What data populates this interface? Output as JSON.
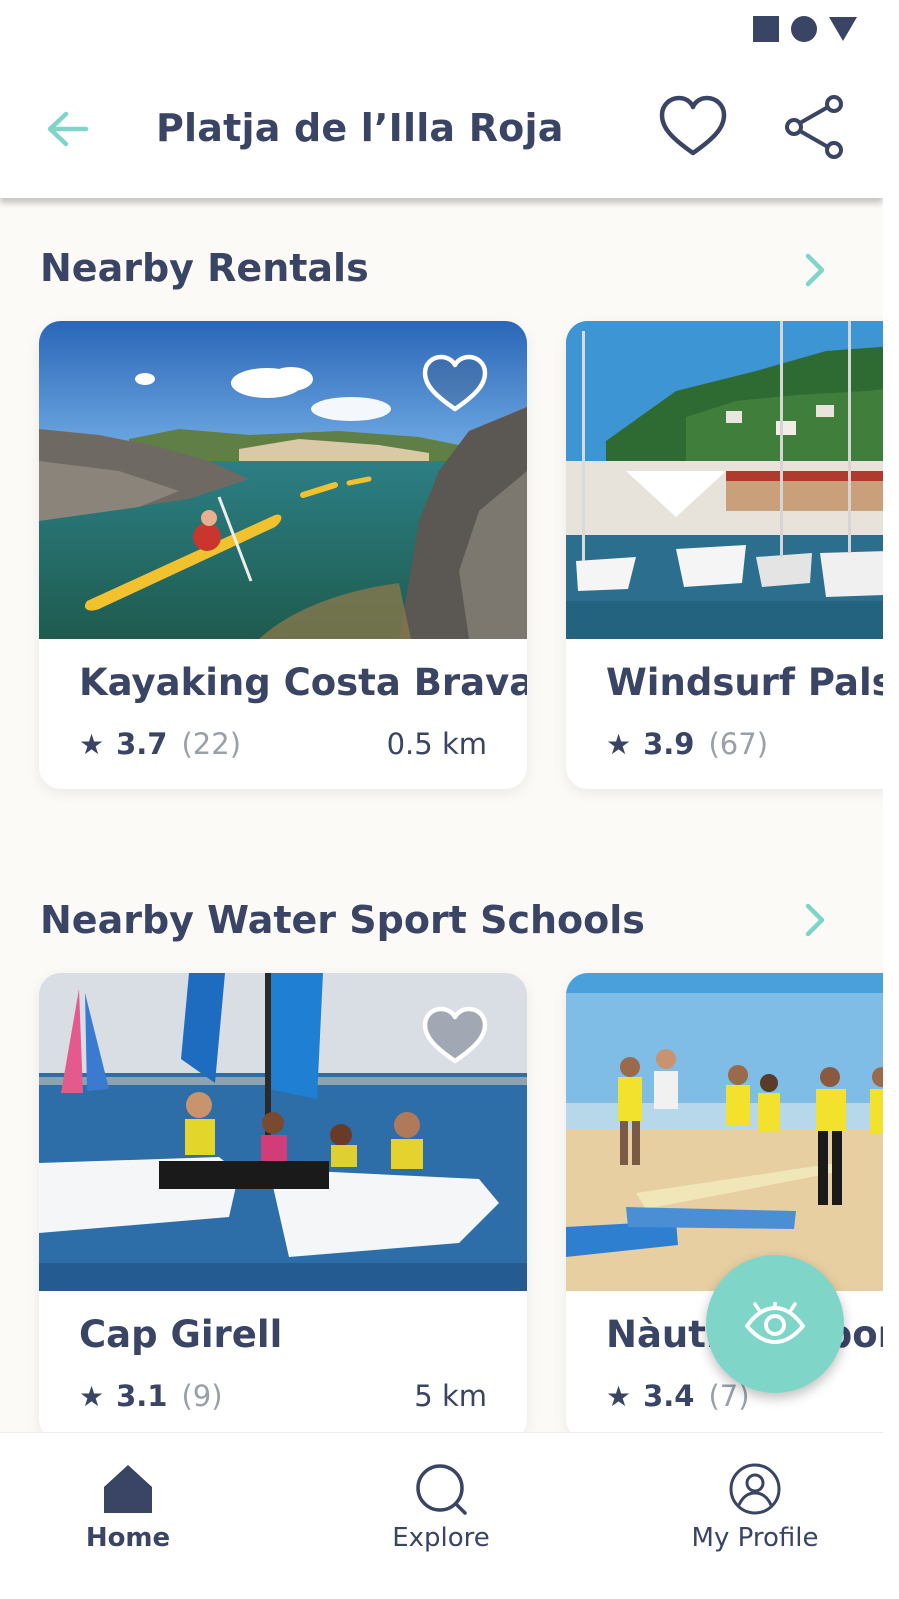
{
  "status_bar": {
    "icons": [
      "square-icon",
      "circle-icon",
      "triangle-icon"
    ]
  },
  "header": {
    "title": "Platja de l’Illa Roja",
    "icons": {
      "back": "arrow-left-icon",
      "favorite": "heart-outline-icon",
      "share": "share-icon"
    }
  },
  "rentals": {
    "title": "Nearby Rentals",
    "cards": [
      {
        "name": "Kayaking Costa Brava",
        "rating": "3.7",
        "reviews": "(22)",
        "distance": "0.5 km"
      },
      {
        "name": "Windsurf Pals",
        "rating": "3.9",
        "reviews": "(67)"
      }
    ]
  },
  "schools": {
    "title": "Nearby Water Sport Schools",
    "cards": [
      {
        "name": "Cap Girell",
        "rating": "3.1",
        "reviews": "(9)",
        "distance": "5 km"
      },
      {
        "name": "Nàutica Esports",
        "rating": "3.4",
        "reviews": "(7)"
      }
    ]
  },
  "star_glyph": "★",
  "fab": {
    "icon": "eye-icon"
  },
  "nav": {
    "items": [
      {
        "label": "Home",
        "icon": "home-icon",
        "active": true
      },
      {
        "label": "Explore",
        "icon": "search-icon",
        "active": false
      },
      {
        "label": "My Profile",
        "icon": "profile-icon",
        "active": false
      }
    ]
  },
  "colors": {
    "text": "#3A4565",
    "accent": "#7FD6C8",
    "background": "#FCFAF6",
    "muted": "#9AA0A8"
  }
}
